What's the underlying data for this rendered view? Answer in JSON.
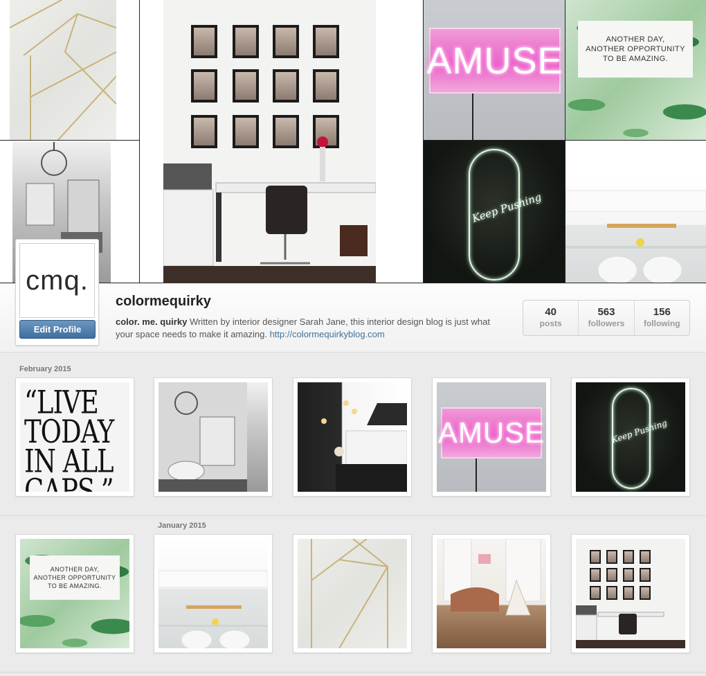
{
  "cover": {
    "neon_word": "AMUSE",
    "quote_lines": [
      "ANOTHER DAY,",
      "ANOTHER OPPORTUNITY",
      "TO BE AMAZING."
    ],
    "skate_label": "Keep Pushing"
  },
  "profile": {
    "avatar_text": "cmq.",
    "edit_button": "Edit Profile",
    "username": "colormequirky",
    "bio_name": "color. me. quirky",
    "bio_text": " Written by interior designer Sarah Jane, this interior design blog is just what your space needs to make it amazing. ",
    "bio_link": "http://colormequirkyblog.com",
    "stats": [
      {
        "value": "40",
        "label": "posts"
      },
      {
        "value": "563",
        "label": "followers"
      },
      {
        "value": "156",
        "label": "following"
      }
    ]
  },
  "feed": {
    "sections": [
      {
        "month": "February 2015",
        "photos": [
          {
            "subject": "typography-quote",
            "text_lines": [
              "“LIVE",
              "TODAY",
              "IN ALL",
              "CAPS.”"
            ]
          },
          {
            "subject": "bw-parlor"
          },
          {
            "subject": "dark-kitchen"
          },
          {
            "subject": "neon-amuse",
            "text": "AMUSE"
          },
          {
            "subject": "neon-skateboard",
            "text": "Keep Pushing"
          }
        ]
      },
      {
        "month": "January 2015",
        "photos": [
          {
            "subject": "palm-quote",
            "text_lines": [
              "ANOTHER DAY,",
              "ANOTHER OPPORTUNITY",
              "TO BE AMAZING."
            ]
          },
          {
            "subject": "white-kitchen"
          },
          {
            "subject": "marble-tile"
          },
          {
            "subject": "living-room"
          },
          {
            "subject": "office-gallery-wall"
          }
        ]
      }
    ]
  },
  "colors": {
    "link": "#3f729b",
    "button": "#4a79a8",
    "background": "#ebebeb"
  }
}
